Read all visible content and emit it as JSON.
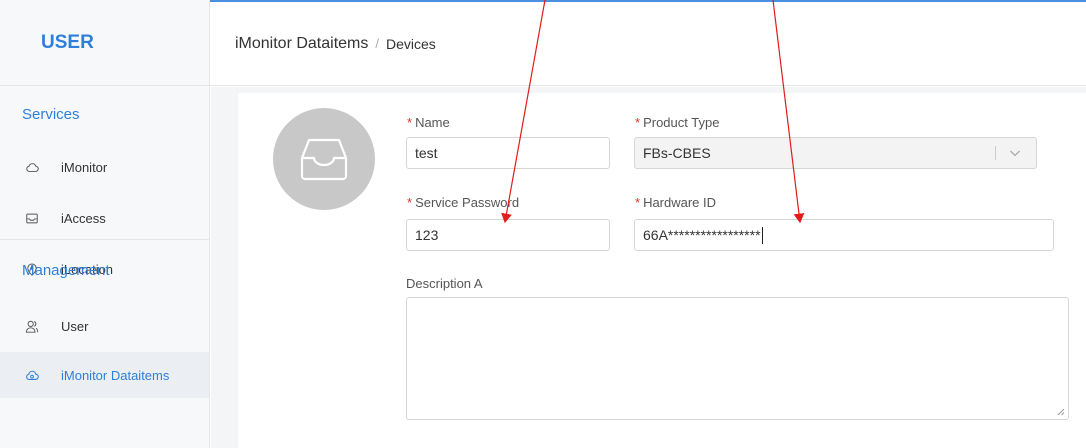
{
  "brand": {
    "title": "USER"
  },
  "sidebar": {
    "services_title": "Services",
    "services": [
      {
        "label": "iMonitor",
        "icon": "cloud-icon"
      },
      {
        "label": "iAccess",
        "icon": "inbox-icon"
      },
      {
        "label": "iLocation",
        "icon": "location-pin-icon"
      }
    ],
    "management_title": "Management",
    "management": [
      {
        "label": "User",
        "icon": "users-icon"
      },
      {
        "label": "iMonitor Dataitems",
        "icon": "cloud-sync-icon",
        "active": true
      }
    ]
  },
  "breadcrumb": {
    "root": "iMonitor Dataitems",
    "separator": "/",
    "current": "Devices"
  },
  "form": {
    "required_mark": "*",
    "name": {
      "label": "Name",
      "value": "test"
    },
    "product_type": {
      "label": "Product Type",
      "value": "FBs-CBES"
    },
    "service_password": {
      "label": "Service Password",
      "value": "123"
    },
    "hardware_id": {
      "label": "Hardware ID",
      "value": "66A*****************"
    },
    "description": {
      "label": "Description A",
      "value": ""
    }
  },
  "colors": {
    "accent": "#2f7fd8",
    "required": "#e0302f",
    "annotation_arrow": "#e21b1b"
  }
}
